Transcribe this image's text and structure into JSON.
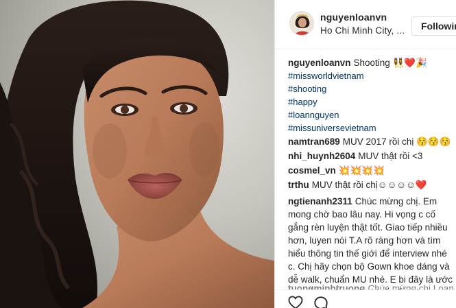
{
  "post": {
    "username": "nguyenloanvn",
    "location": "Ho Chi Minh City, ...",
    "follow_label": "Followin",
    "photo_alt": "Portrait photo"
  },
  "caption": {
    "author": "nguyenloanvn",
    "text": "Shooting 👯‍♀️❤️🎉",
    "hashtags": [
      "#missworldvietnam",
      "#shooting",
      "#happy",
      "#loannguyen",
      "#missuniversevietnam"
    ]
  },
  "comments": [
    {
      "author": "namtran689",
      "text": "MUV 2017 rồi chị 😚😚😚"
    },
    {
      "author": "nhi_huynh2604",
      "text": "MUV thật rồi <3"
    },
    {
      "author": "cosmel_vn",
      "text": "💥💥💥💥"
    },
    {
      "author": "trthu",
      "text": "MUV thật rồi chị☺☺☺☺❤️"
    },
    {
      "author": "ngtienanh2311",
      "text": "Chúc mừng chị. Em mong chờ bao lâu nay. Hi vọng c cố gắng rèn luyện thật tốt. Giao tiếp nhiều hơn, luyen nói T.A rõ ràng hơn và tìm hiểu thông tin thế giới để interview nhé c. Chị hãy chọn bộ Gown khoe dáng và dễ walk, chuẩn MU nhé. E bi đây là ước mơ của c nên c sẽ cbi rất tốt. Chúc c siêu thành công😘😘"
    },
    {
      "author": "tuongminhtruong",
      "text": "Chúc mừng chị Loan với"
    }
  ],
  "icons": {
    "heart": "heart-icon",
    "comment": "comment-icon"
  },
  "colors": {
    "hashtag": "#003569",
    "text": "#262626",
    "border": "#dbdbdb"
  }
}
